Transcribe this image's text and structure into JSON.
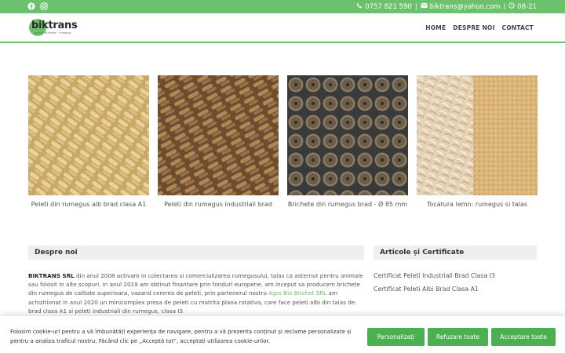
{
  "topbar": {
    "phone": "0757 821 590",
    "email": "biktrans@yahoo.com",
    "hours": "08-21",
    "separator": "|"
  },
  "header": {
    "logo_text": "biktrans",
    "logo_tagline": "peleti · brichete · rumegus",
    "nav": [
      "HOME",
      "DESPRE NOI",
      "CONTACT"
    ]
  },
  "products": [
    {
      "caption": "Peleti din rumegus alb brad clasa A1"
    },
    {
      "caption": "Peleti din rumegus industriali brad"
    },
    {
      "caption": "Brichete din rumegus brad - Ø 85 mm"
    },
    {
      "caption": "Tocatura lemn: rumegus si talas"
    }
  ],
  "about": {
    "title": "Despre noi",
    "company": "BIKTRANS SRL",
    "text1": " din anul 2008 activam in colectarea si comercializarea rumegusului, talas ca asternut pentru animale sau folosit in alte scopuri. In anul 2019 am obtinut finantare prin fonduri europene, am inceput sa producem brichete din rumegus de calitate superioara, vazand cererea de peleti, prin partenerul nostru ",
    "partner": "Agro Bio Brichet SRL",
    "text2": " am achizitionat in anul 2020 un minicomplex presa de peleti cu matrita plana rotativa, care face peleti albi din talas de brad clasa A1 si peleti industriali din rumegus, clasa I3."
  },
  "certs": {
    "title": "Articole și Certificate",
    "items": [
      "Certificat Peleti Industriali Brad Clasa I3",
      "Certificat Peleti Albi Brad Clasa A1"
    ]
  },
  "cookie": {
    "message": "Folosim cookie-uri pentru a vă îmbunătăți experiența de navigare, pentru a vă prezenta conținut și reclame personalizate și pentru a analiza traficul nostru. Făcând clic pe „Acceptă tot”, acceptați utilizarea cookie-urilor.",
    "customize": "Personalizați",
    "reject": "Refuzare toate",
    "accept": "Acceptare toate"
  },
  "colors": {
    "accent": "#6cc16c",
    "button": "#4caf50"
  }
}
